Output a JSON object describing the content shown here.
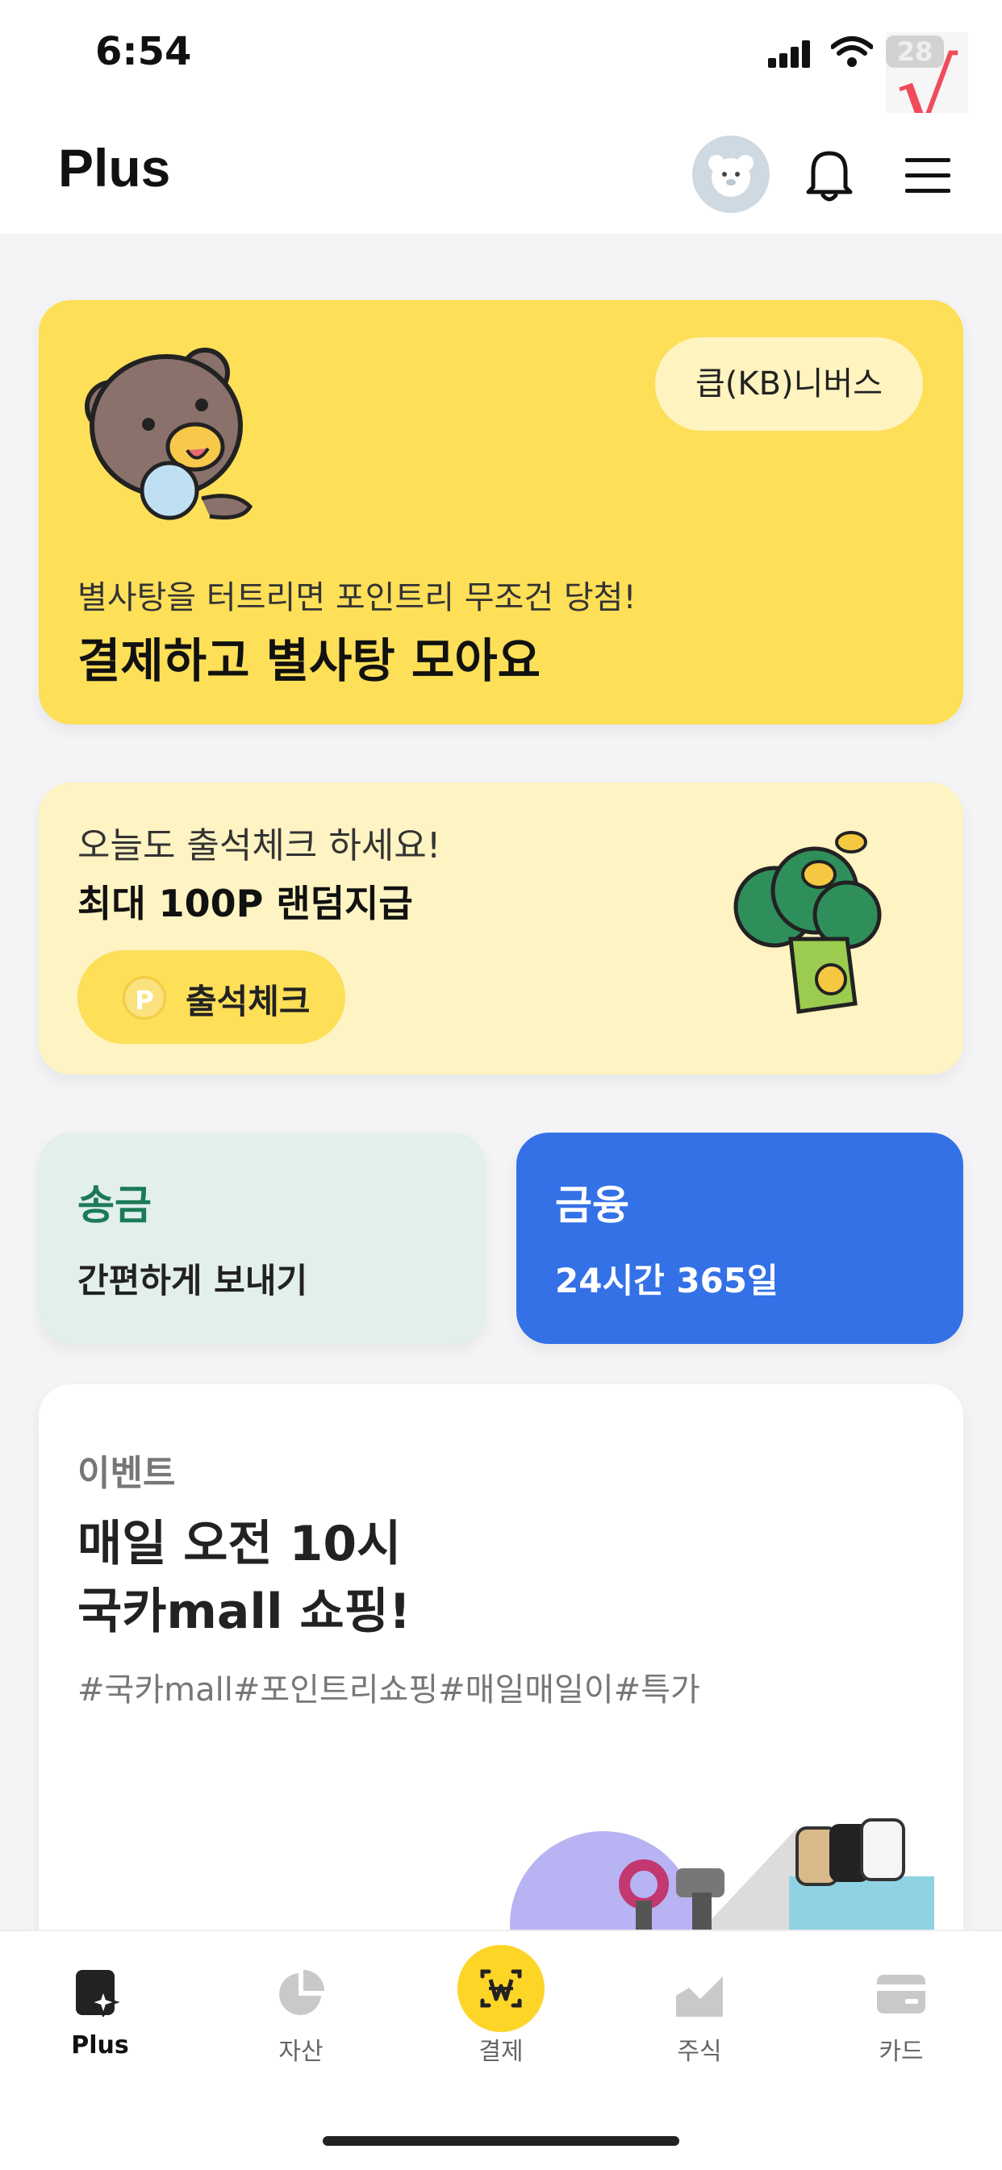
{
  "status_bar": {
    "time": "6:54",
    "battery": "28"
  },
  "header": {
    "title": "Plus"
  },
  "star_card": {
    "pill_label": "큽(KB)니버스",
    "subtitle": "별사탕을 터트리면 포인트리 무조건 당첨!",
    "title": "결제하고 별사탕 모아요"
  },
  "attendance_card": {
    "subtitle": "오늘도 출석체크 하세요!",
    "title": "최대 100P 랜덤지급",
    "button_label": "출석체크",
    "coin_letter": "P"
  },
  "transfer_card": {
    "title": "송금",
    "subtitle": "간편하게 보내기"
  },
  "finance_card": {
    "title": "금융",
    "subtitle": "24시간 365일"
  },
  "event_card": {
    "label": "이벤트",
    "title_line1": "매일 오전 10시",
    "title_line2": "국카mall 쇼핑!",
    "tags": "#국카mall#포인트리쇼핑#매일매일이#특가"
  },
  "tabbar": {
    "items": [
      {
        "label": "Plus",
        "icon": "plus-star-icon",
        "active": true
      },
      {
        "label": "자산",
        "icon": "pie-chart-icon",
        "active": false
      },
      {
        "label": "결제",
        "icon": "won-pay-icon",
        "active": false
      },
      {
        "label": "주식",
        "icon": "stock-chart-icon",
        "active": false
      },
      {
        "label": "카드",
        "icon": "card-icon",
        "active": false
      }
    ]
  },
  "colors": {
    "yellow": "#fddf58",
    "light_yellow": "#fef3c2",
    "mint": "#e2efec",
    "green_text": "#1b7b56",
    "blue": "#3471e6"
  }
}
